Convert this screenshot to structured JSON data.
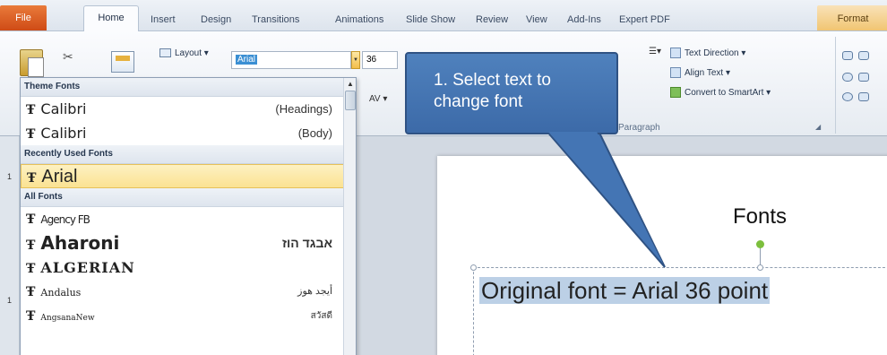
{
  "tabs": {
    "file": "File",
    "home": "Home",
    "others": [
      "Insert",
      "Design",
      "Transitions",
      "Animations",
      "Slide Show",
      "Review",
      "View",
      "Add-Ins",
      "Expert PDF"
    ],
    "format": "Format"
  },
  "ribbon": {
    "layout": "Layout",
    "font_name": "Arial",
    "font_size": "36",
    "text_direction": "Text Direction",
    "align_text": "Align Text",
    "convert_smartart": "Convert to SmartArt",
    "paragraph_label": "Paragraph"
  },
  "font_panel": {
    "theme_header": "Theme Fonts",
    "theme_fonts": [
      {
        "name": "Calibri",
        "note": "(Headings)"
      },
      {
        "name": "Calibri",
        "note": "(Body)"
      }
    ],
    "recent_header": "Recently Used Fonts",
    "recent_font": "Arial",
    "all_header": "All Fonts",
    "all_fonts": [
      {
        "name": "Agency FB",
        "sample": ""
      },
      {
        "name": "Aharoni",
        "sample": "אבגד הוז"
      },
      {
        "name": "ALGERIAN",
        "sample": ""
      },
      {
        "name": "Andalus",
        "sample": "أيجد هوز"
      },
      {
        "name": "AngsanaNew",
        "sample": "สวัสดี"
      }
    ]
  },
  "callout": {
    "text": "1. Select text to\nchange font"
  },
  "slide": {
    "title": "Fonts",
    "body": "Original font = Arial 36 point",
    "thumb_numbers": [
      "1",
      "1"
    ]
  }
}
